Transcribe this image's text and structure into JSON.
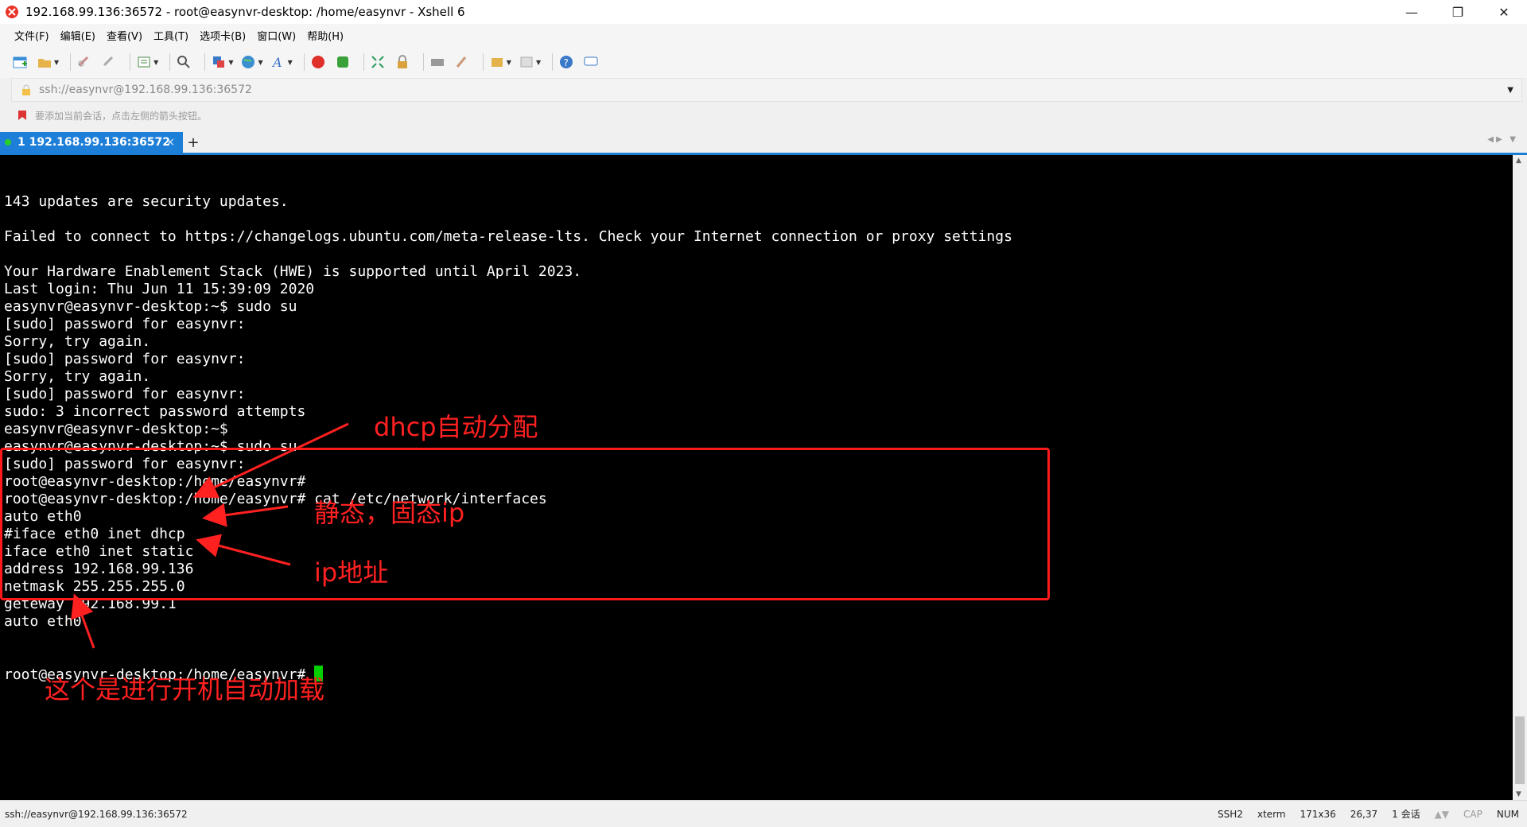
{
  "window": {
    "title": "192.168.99.136:36572 - root@easynvr-desktop: /home/easynvr - Xshell 6",
    "minimize": "—",
    "restore": "❐",
    "close": "✕"
  },
  "menu": [
    "文件(F)",
    "编辑(E)",
    "查看(V)",
    "工具(T)",
    "选项卡(B)",
    "窗口(W)",
    "帮助(H)"
  ],
  "address_bar": {
    "value": "ssh://easynvr@192.168.99.136:36572"
  },
  "hint": "要添加当前会话，点击左侧的箭头按钮。",
  "tabs": [
    {
      "label": "1 192.168.99.136:36572",
      "close": "×"
    }
  ],
  "tab_add": "+",
  "terminal_lines": [
    "143 updates are security updates.",
    "",
    "Failed to connect to https://changelogs.ubuntu.com/meta-release-lts. Check your Internet connection or proxy settings",
    "",
    "Your Hardware Enablement Stack (HWE) is supported until April 2023.",
    "Last login: Thu Jun 11 15:39:09 2020",
    "easynvr@easynvr-desktop:~$ sudo su",
    "[sudo] password for easynvr:",
    "Sorry, try again.",
    "[sudo] password for easynvr:",
    "Sorry, try again.",
    "[sudo] password for easynvr:",
    "sudo: 3 incorrect password attempts",
    "easynvr@easynvr-desktop:~$",
    "easynvr@easynvr-desktop:~$ sudo su",
    "[sudo] password for easynvr:",
    "root@easynvr-desktop:/home/easynvr#",
    "root@easynvr-desktop:/home/easynvr# cat /etc/network/interfaces",
    "auto eth0",
    "#iface eth0 inet dhcp",
    "iface eth0 inet static",
    "address 192.168.99.136",
    "netmask 255.255.255.0",
    "geteway 192.168.99.1",
    "auto eth0"
  ],
  "prompt": "root@easynvr-desktop:/home/easynvr# ",
  "annotations": {
    "dhcp": "dhcp自动分配",
    "static": "静态，固态ip",
    "ip": "ip地址",
    "auto": "这个是进行开机自动加载"
  },
  "status": {
    "connection": "ssh://easynvr@192.168.99.136:36572",
    "protocol": "SSH2",
    "term": "xterm",
    "size": "171x36",
    "position": "26,37",
    "sessions": "1 会话",
    "cap": "CAP",
    "num": "NUM"
  },
  "colors": {
    "accent": "#1e7fd8",
    "annotation": "#ff2020",
    "cursor": "#00d000"
  },
  "icons": [
    "new-session-icon",
    "open-folder-icon",
    "connect-icon",
    "disconnect-icon",
    "properties-icon",
    "find-icon",
    "transfer-icon",
    "globe-icon",
    "font-icon",
    "xshell-icon",
    "xftp-icon",
    "fullscreen-icon",
    "lock-icon",
    "keyboard-icon",
    "highlight-icon",
    "compose-icon",
    "layout-icon",
    "help-icon",
    "chat-icon"
  ]
}
